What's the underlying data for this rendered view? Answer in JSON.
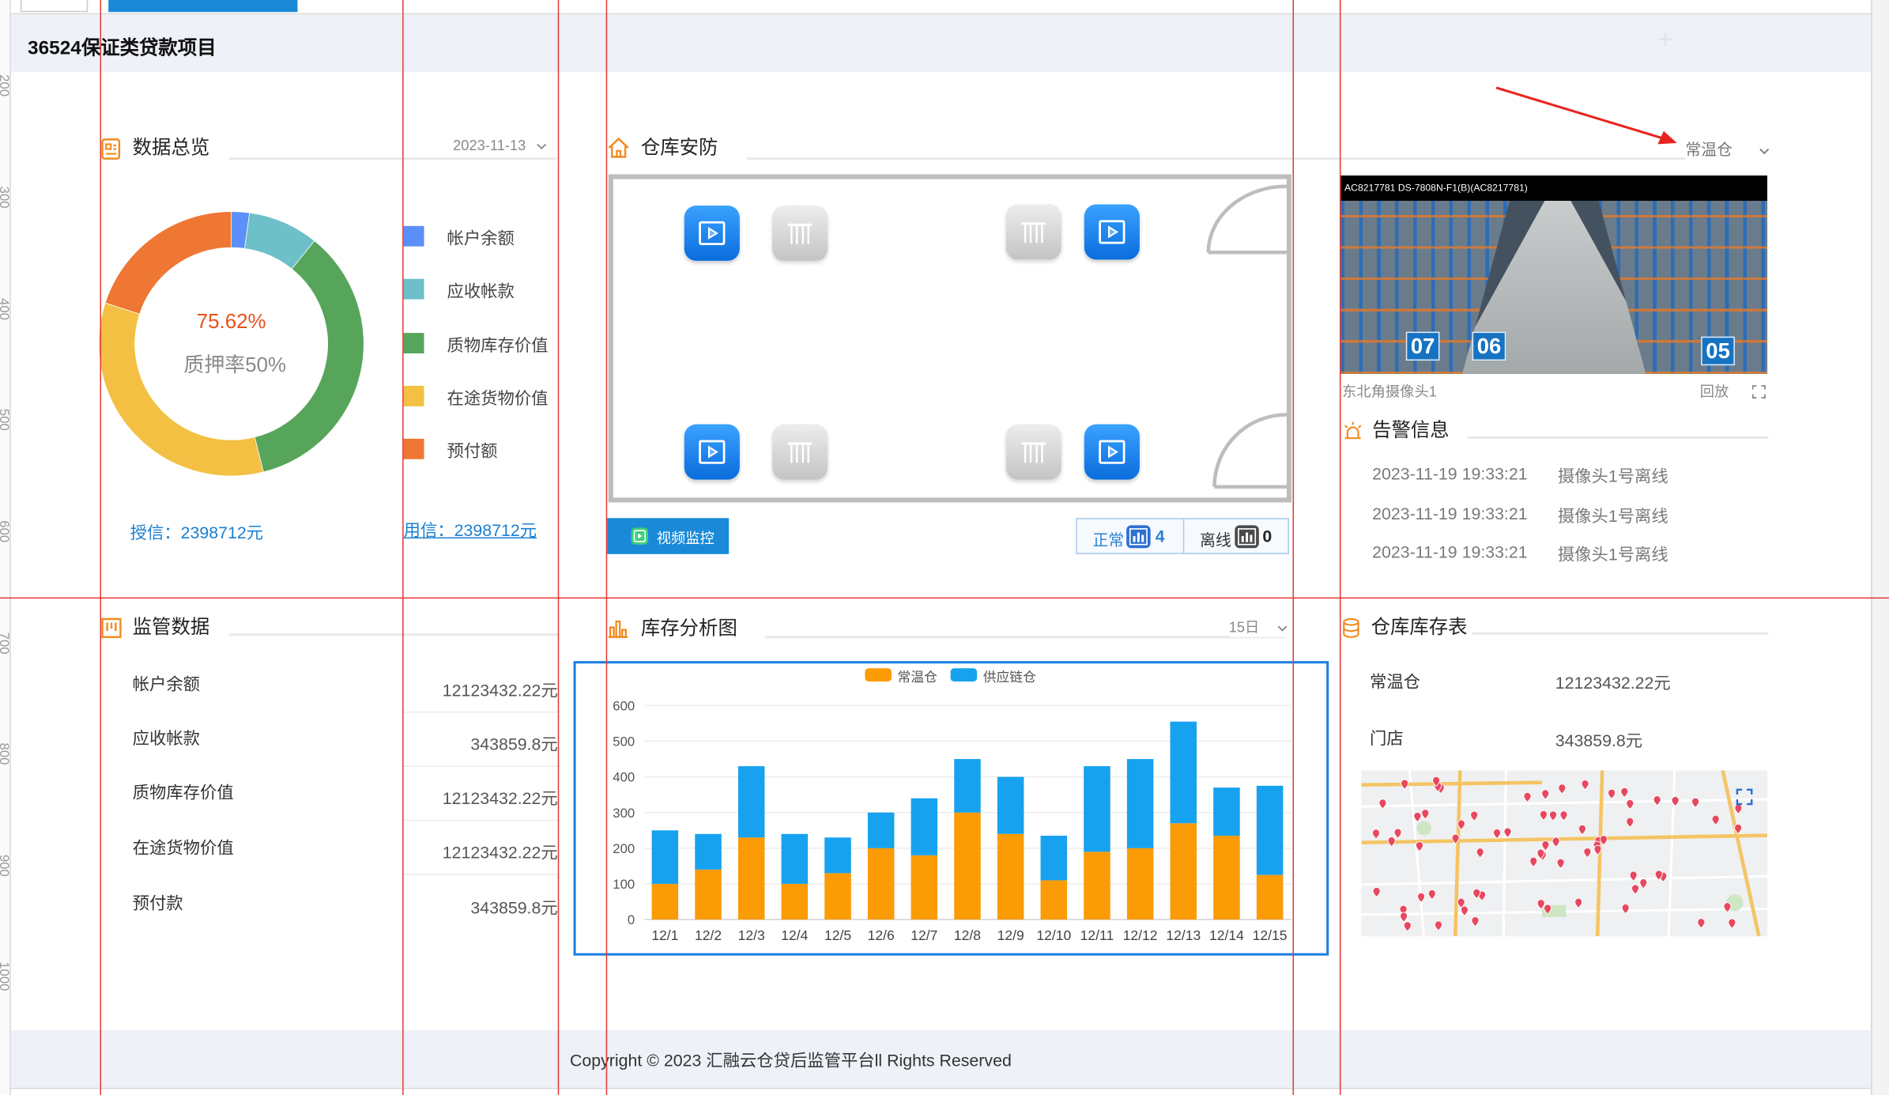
{
  "ruler": {
    "labels": [
      "200",
      "300",
      "400",
      "500",
      "600",
      "700",
      "800",
      "900",
      "1000"
    ]
  },
  "header": {
    "title": "36524保证类贷款项目",
    "plus": "+"
  },
  "overview": {
    "title": "数据总览",
    "date": "2023-11-13",
    "percent": "75.62%",
    "pledge_label": "质押率50%",
    "credit": "授信：2398712元",
    "used": "用信：2398712元"
  },
  "warehouse": {
    "title": "仓库安防",
    "select": "常温仓",
    "video_button": "视频监控",
    "status_normal_label": "正常",
    "status_normal_count": "4",
    "status_offline_label": "离线",
    "status_offline_count": "0"
  },
  "camera": {
    "osd": "AC8217781  DS-7808N-F1(B)(AC8217781)",
    "rack_numbers": [
      "07",
      "06",
      "05"
    ],
    "name": "东北角摄像头1",
    "playback": "回放"
  },
  "alerts": {
    "title": "告警信息",
    "items": [
      {
        "time": "2023-11-19 19:33:21",
        "message": "摄像头1号离线"
      },
      {
        "time": "2023-11-19 19:33:21",
        "message": "摄像头1号离线"
      },
      {
        "time": "2023-11-19 19:33:21",
        "message": "摄像头1号离线"
      }
    ]
  },
  "supervision": {
    "title": "监管数据",
    "rows": [
      {
        "label": "帐户余额",
        "value": "12123432.22元"
      },
      {
        "label": "应收帐款",
        "value": "343859.8元"
      },
      {
        "label": "质物库存价值",
        "value": "12123432.22元"
      },
      {
        "label": "在途货物价值",
        "value": "12123432.22元"
      },
      {
        "label": "预付款",
        "value": "343859.8元"
      }
    ]
  },
  "inventory": {
    "title": "库存分析图",
    "range": "15日"
  },
  "stock_table": {
    "title": "仓库库存表",
    "rows": [
      {
        "label": "常温仓",
        "value": "12123432.22元"
      },
      {
        "label": "门店",
        "value": "343859.8元"
      }
    ]
  },
  "footer": {
    "copyright": "Copyright © 2023 汇融云仓贷后监管平台ll Rights Reserved"
  },
  "colors": {
    "accent": "#1a8ad8",
    "icon_orange": "#f28a1d",
    "guide_red": "#e53935",
    "header_bg": "#eef1f7"
  },
  "chart_data": [
    {
      "type": "pie",
      "labels": [
        "帐户余额",
        "应收帐款",
        "质物库存价值",
        "在途货物价值",
        "预付额"
      ],
      "values": [
        2.2,
        8.6,
        35.3,
        33.9,
        20.0
      ],
      "colors": [
        "#5b8ff9",
        "#6dbfc8",
        "#57a55a",
        "#f3c043",
        "#ee7733"
      ],
      "legend": "right"
    },
    {
      "type": "bar",
      "stacked": true,
      "categories": [
        "12/1",
        "12/2",
        "12/3",
        "12/4",
        "12/5",
        "12/6",
        "12/7",
        "12/8",
        "12/9",
        "12/10",
        "12/11",
        "12/12",
        "12/13",
        "12/14",
        "12/15"
      ],
      "series": [
        {
          "name": "常温仓",
          "color": "#fb9b06",
          "values": [
            100,
            140,
            230,
            100,
            130,
            200,
            180,
            300,
            240,
            110,
            190,
            200,
            270,
            235,
            125
          ]
        },
        {
          "name": "供应链仓",
          "color": "#17a2ef",
          "values": [
            150,
            100,
            200,
            140,
            100,
            100,
            160,
            150,
            160,
            125,
            240,
            250,
            285,
            135,
            250
          ]
        }
      ],
      "ylim": [
        0,
        600
      ],
      "yticks": [
        "0",
        "100",
        "200",
        "300",
        "400",
        "500",
        "600"
      ],
      "grid": true,
      "legend": "top-center"
    }
  ]
}
